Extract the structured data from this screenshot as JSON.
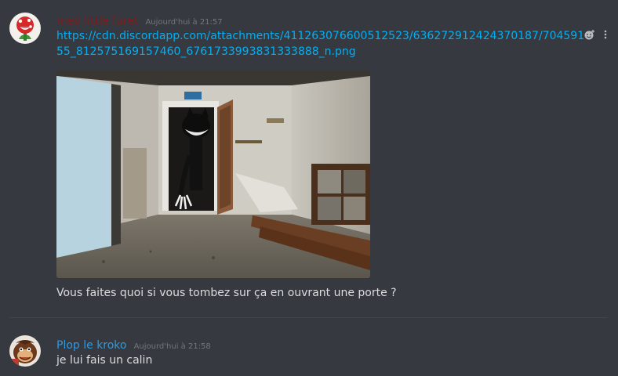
{
  "messages": [
    {
      "username": "meo little furet",
      "username_color": "#7a1c1c",
      "timestamp": "Aujourd'hui à 21:57",
      "link": "https://cdn.discordapp.com/attachments/411263076600512523/636272912424370187/70459155_812575169157460_6761733993831333888_n.png",
      "text": "Vous faites quoi si vous tombez sur ça en ouvrant une porte ?",
      "avatar_icon": "piranha-plant-avatar"
    },
    {
      "username": "Plop le kroko",
      "username_color": "#3498db",
      "timestamp": "Aujourd'hui à 21:58",
      "text": "je lui fais un calin",
      "avatar_icon": "donkey-kong-avatar"
    }
  ],
  "actions": {
    "reaction_icon": "add-reaction-icon",
    "more_icon": "more-options-icon"
  },
  "colors": {
    "background": "#36393f",
    "link": "#00b0f4",
    "text": "#dcddde",
    "timestamp": "#72767d"
  }
}
